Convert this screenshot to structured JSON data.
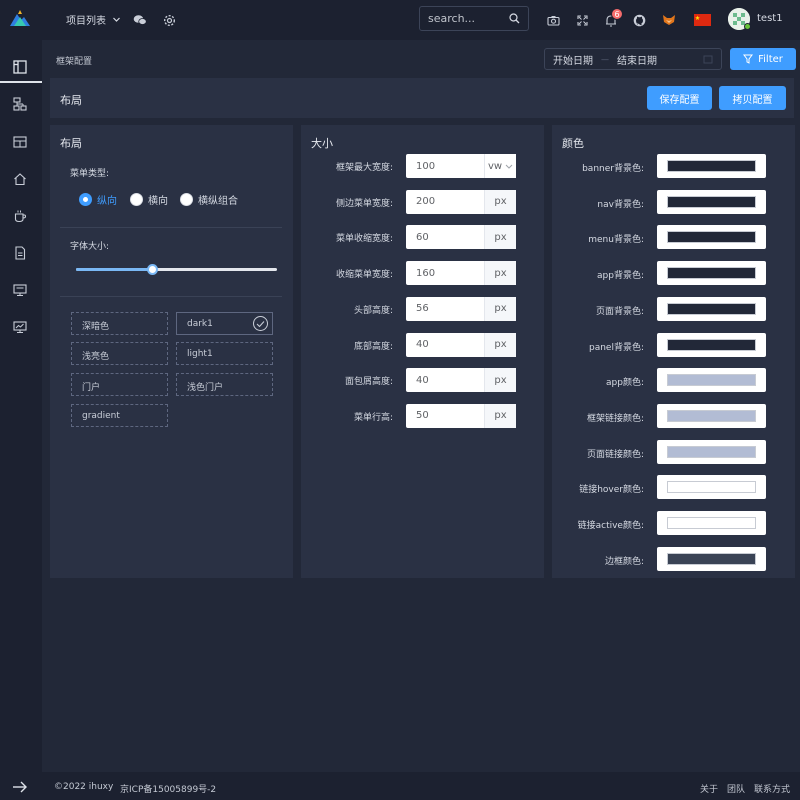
{
  "header": {
    "project_menu": "项目列表",
    "search_placeholder": "search...",
    "notification_count": "6",
    "username": "test1"
  },
  "breadcrumb": "框架配置",
  "date_range": {
    "start": "开始日期",
    "end": "结束日期"
  },
  "filter_label": "Filter",
  "page": {
    "title": "布局",
    "save_label": "保存配置",
    "copy_label": "拷贝配置"
  },
  "layout_panel": {
    "title": "布局",
    "menu_type_label": "菜单类型:",
    "menu_types": [
      "纵向",
      "横向",
      "横纵组合"
    ],
    "menu_type_selected": "纵向",
    "font_size_label": "字体大小:",
    "font_size_level": 0.38,
    "themes": [
      "深暗色",
      "dark1",
      "浅亮色",
      "light1",
      "门户",
      "浅色门户",
      "gradient"
    ],
    "theme_selected": "dark1"
  },
  "size_panel": {
    "title": "大小",
    "rows": [
      {
        "label": "框架最大宽度:",
        "value": "100",
        "unit": "vw",
        "selectable": true
      },
      {
        "label": "侧边菜单宽度:",
        "value": "200",
        "unit": "px"
      },
      {
        "label": "菜单收缩宽度:",
        "value": "60",
        "unit": "px"
      },
      {
        "label": "收缩菜单宽度:",
        "value": "160",
        "unit": "px"
      },
      {
        "label": "头部高度:",
        "value": "56",
        "unit": "px"
      },
      {
        "label": "底部高度:",
        "value": "40",
        "unit": "px"
      },
      {
        "label": "面包屑高度:",
        "value": "40",
        "unit": "px"
      },
      {
        "label": "菜单行高:",
        "value": "50",
        "unit": "px"
      }
    ]
  },
  "color_panel": {
    "title": "颜色",
    "rows": [
      {
        "label": "banner背景色:",
        "color": "#222838"
      },
      {
        "label": "nav背景色:",
        "color": "#222838"
      },
      {
        "label": "menu背景色:",
        "color": "#222838"
      },
      {
        "label": "app背景色:",
        "color": "#222838"
      },
      {
        "label": "页面背景色:",
        "color": "#222838"
      },
      {
        "label": "panel背景色:",
        "color": "#222838"
      },
      {
        "label": "app颜色:",
        "color": "#b2bcd4"
      },
      {
        "label": "框架链接颜色:",
        "color": "#b2bcd4"
      },
      {
        "label": "页面链接颜色:",
        "color": "#b2bcd4"
      },
      {
        "label": "链接hover颜色:",
        "color": "#ffffff"
      },
      {
        "label": "链接active颜色:",
        "color": "#ffffff"
      },
      {
        "label": "边框颜色:",
        "color": "#3a4355"
      }
    ]
  },
  "footer": {
    "copyright": "©2022 ihuxy",
    "icp": "京ICP备15005899号-2",
    "links": [
      "关于",
      "团队",
      "联系方式"
    ]
  },
  "colors": {
    "accent": "#3f9dff",
    "background": "#222838",
    "panel": "#2a3144",
    "chrome": "#1c2130"
  }
}
